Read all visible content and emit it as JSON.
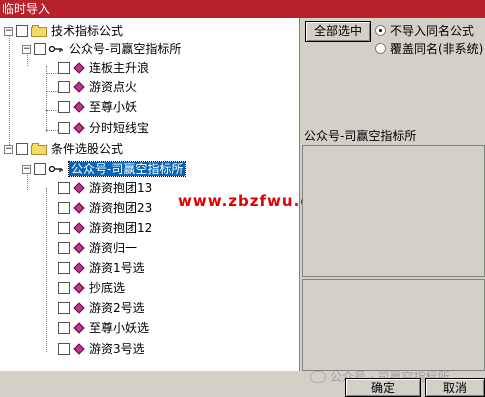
{
  "window": {
    "title": "临时导入"
  },
  "tree": {
    "group1": {
      "label": "技术指标公式",
      "child": {
        "label": "公众号-司赢空指标所",
        "items": [
          "连板主升浪",
          "游资点火",
          "至尊小妖",
          "分时短线宝"
        ]
      }
    },
    "group2": {
      "label": "条件选股公式",
      "child": {
        "label": "公众号-司赢空指标所",
        "items": [
          "游资抱团13",
          "游资抱团23",
          "游资抱团12",
          "游资归一",
          "游资1号选",
          "抄底选",
          "游资2号选",
          "至尊小妖选",
          "游资3号选"
        ]
      }
    }
  },
  "watermark": "www.zbzfwu.com",
  "right": {
    "select_all": "全部选中",
    "radio_skip": "不导入同名公式",
    "radio_overwrite": "覆盖同名(非系统)",
    "info_text": "公众号-司赢空指标所"
  },
  "bottom": {
    "watermark_text": "公众号 · 司赢空指标所",
    "ok": "确定",
    "cancel": "取消"
  }
}
